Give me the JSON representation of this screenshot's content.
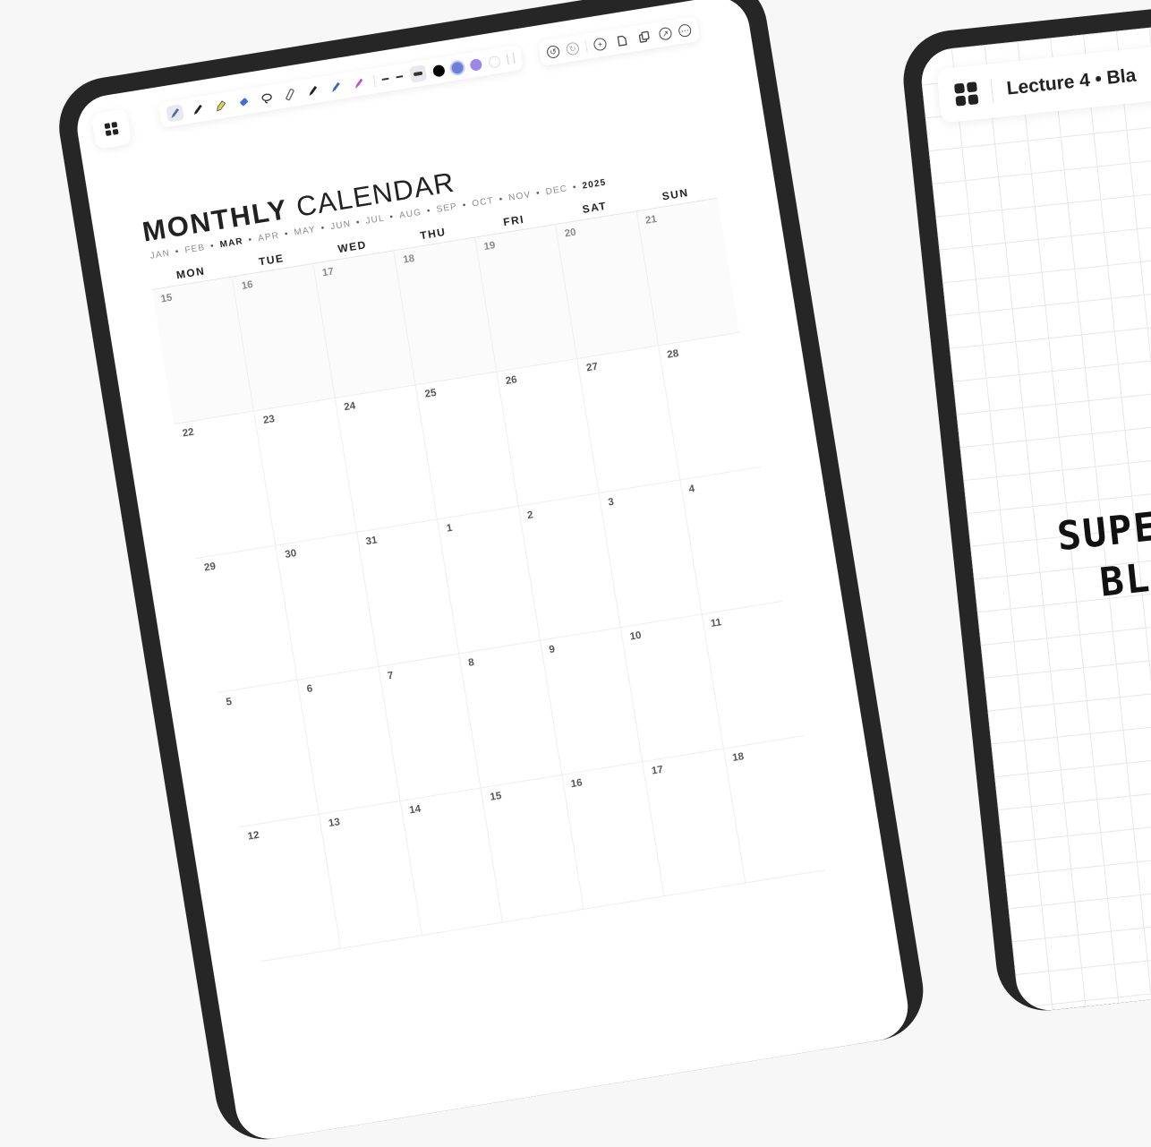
{
  "left_tablet": {
    "toolbar": {
      "tools": [
        {
          "name": "fountain-pen-icon",
          "color": "#5b6b9e",
          "selected": true
        },
        {
          "name": "ballpoint-pen-icon",
          "color": "#222222",
          "selected": false
        },
        {
          "name": "highlighter-yellow-icon",
          "color": "#e8d34a",
          "selected": false
        },
        {
          "name": "eraser-icon",
          "color": "#3d6fd6",
          "selected": false
        },
        {
          "name": "lasso-icon",
          "color": "#333333",
          "selected": false
        },
        {
          "name": "ruler-icon",
          "color": "#555555",
          "selected": false
        },
        {
          "name": "marker-black-icon",
          "color": "#222222",
          "selected": false
        },
        {
          "name": "marker-blue-icon",
          "color": "#3b5fd6",
          "selected": false
        },
        {
          "name": "marker-pink-icon",
          "color": "#c44fd9",
          "selected": false
        }
      ],
      "colors": [
        "#000000",
        "#6d7fd6",
        "#9b87e8",
        "#ffffff"
      ],
      "undo_icon": "undo-icon",
      "redo_icon": "redo-icon",
      "actions": [
        "add-page-icon",
        "export-icon",
        "copy-icon",
        "expand-icon",
        "more-icon"
      ]
    },
    "title_bold": "MONTHLY",
    "title_light": "CALENDAR",
    "months": [
      "JAN",
      "FEB",
      "MAR",
      "APR",
      "MAY",
      "JUN",
      "JUL",
      "AUG",
      "SEP",
      "OCT",
      "NOV",
      "DEC"
    ],
    "current_month": "MAR",
    "year": "2025",
    "weekdays": [
      "MON",
      "TUE",
      "WED",
      "THU",
      "FRI",
      "SAT",
      "SUN"
    ],
    "days": [
      "15",
      "16",
      "17",
      "18",
      "19",
      "20",
      "21",
      "22",
      "23",
      "24",
      "25",
      "26",
      "27",
      "28",
      "29",
      "30",
      "31",
      "1",
      "2",
      "3",
      "4",
      "5",
      "6",
      "7",
      "8",
      "9",
      "10",
      "11",
      "12",
      "13",
      "14",
      "15",
      "16",
      "17",
      "18"
    ]
  },
  "right_tablet": {
    "lecture_title": "Lecture 4 • Bla",
    "handwriting": [
      "SUPER",
      "BLAC"
    ]
  }
}
